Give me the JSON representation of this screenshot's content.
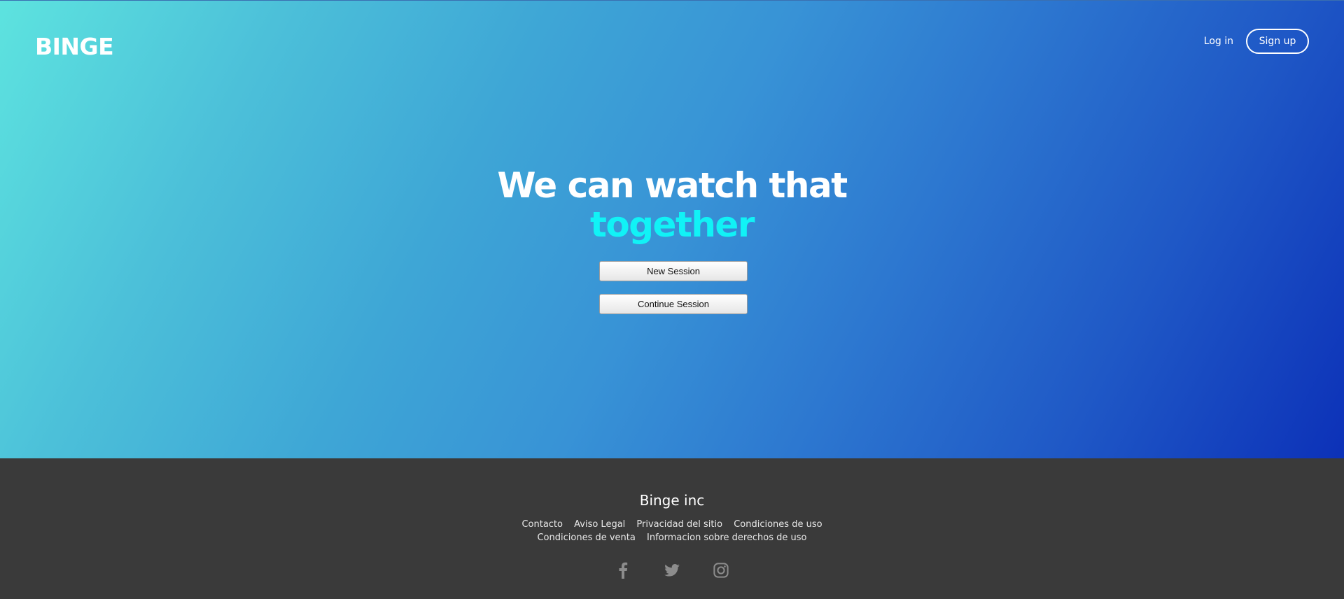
{
  "header": {
    "logo": "BINGE",
    "login_label": "Log in",
    "signup_label": "Sign up"
  },
  "hero": {
    "headline_line1": "We can watch that",
    "headline_line2": "together",
    "new_session_label": "New Session",
    "continue_session_label": "Continue Session"
  },
  "footer": {
    "company": "Binge inc",
    "links_row1": [
      "Contacto",
      "Aviso Legal",
      "Privacidad del sitio",
      "Condiciones de uso"
    ],
    "links_row2": [
      "Condiciones de venta",
      "Informacion sobre derechos de uso"
    ],
    "social_icons": [
      "facebook-icon",
      "twitter-icon",
      "instagram-icon"
    ]
  },
  "colors": {
    "accent": "#11f2f6",
    "gradient_start": "#5de3df",
    "gradient_end": "#0c31b8",
    "footer_bg": "#3a3a3a",
    "social_icon": "#8c8c8c"
  }
}
